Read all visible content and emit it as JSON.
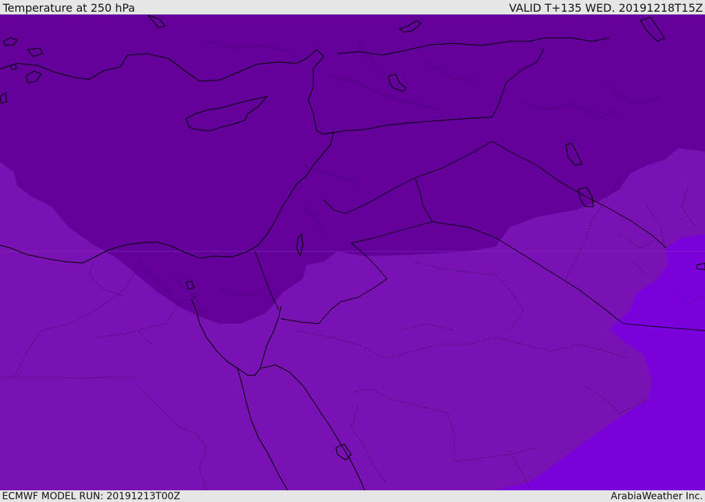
{
  "header": {
    "title": "Temperature at 250 hPa",
    "valid": "VALID T+135 WED. 20191218T15Z"
  },
  "footer": {
    "model_run": "ECMWF MODEL RUN: 20191213T00Z",
    "credit": "ArabiaWeather Inc."
  },
  "colors": {
    "coldest_band": "#63009a",
    "mid_band": "#7812b2",
    "warm_band": "#7a00dc",
    "frame": "#e6e6e6",
    "lines": "#000000"
  },
  "map": {
    "region": "Eastern Mediterranean / Middle East",
    "layers": [
      "temperature-shading",
      "coastlines",
      "country-borders",
      "province-borders"
    ]
  }
}
